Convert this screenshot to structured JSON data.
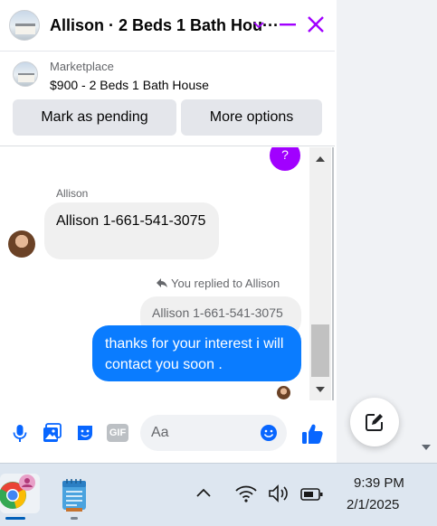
{
  "chat_header": {
    "title": "Allison · 2 Beds 1 Bath Hou···"
  },
  "listing": {
    "source": "Marketplace",
    "title": "$900 - 2 Beds 1 Bath House",
    "mark_pending_label": "Mark as pending",
    "more_options_label": "More options"
  },
  "messages": {
    "top_badge": "?",
    "sender_name": "Allison",
    "incoming_text": "Allison 1-661-541-3075",
    "reply_label": "You replied to Allison",
    "quoted_text": "Allison 1-661-541-3075",
    "outgoing_text": "thanks for your interest i will contact you soon ."
  },
  "composer": {
    "placeholder": "Aa",
    "gif_label": "GIF"
  },
  "taskbar": {
    "time": "9:39 PM",
    "date": "2/1/2025"
  },
  "colors": {
    "accent": "#a100ff",
    "outgoing_bubble": "#0a7cff",
    "icon_blue": "#0866ff"
  }
}
